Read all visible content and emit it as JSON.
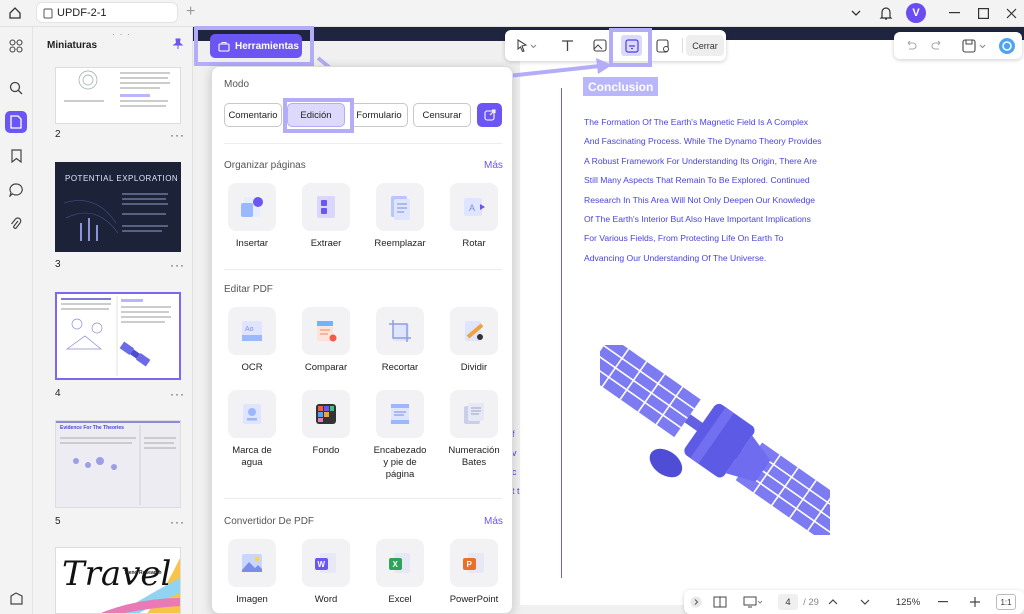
{
  "window": {
    "tab_title": "UPDF-2-1",
    "new_tab_symbol": "+",
    "avatar_letter": "V"
  },
  "thumbnails": {
    "title": "Miniaturas",
    "more_symbol": "···",
    "pages": [
      {
        "number": "2"
      },
      {
        "number": "3",
        "heading": "POTENTIAL EXPLORATION"
      },
      {
        "number": "4"
      },
      {
        "number": "5",
        "heading": "Evidence For The Theories"
      },
      {
        "number": "",
        "heading": "Travel",
        "subheading": "Trend Research"
      }
    ]
  },
  "toolbar": {
    "herramientas_label": "Herramientas",
    "close_label": "Cerrar"
  },
  "tools_panel": {
    "mode_title": "Modo",
    "modes": [
      {
        "label": "Comentario",
        "active": false
      },
      {
        "label": "Edición",
        "active": true
      },
      {
        "label": "Formulario",
        "active": false
      },
      {
        "label": "Censurar",
        "active": false
      }
    ],
    "organize": {
      "title": "Organizar páginas",
      "more": "Más",
      "tools": [
        {
          "label": "Insertar",
          "icon": "insert-icon"
        },
        {
          "label": "Extraer",
          "icon": "extract-icon"
        },
        {
          "label": "Reemplazar",
          "icon": "replace-icon"
        },
        {
          "label": "Rotar",
          "icon": "rotate-icon"
        }
      ]
    },
    "edit": {
      "title": "Editar PDF",
      "tools": [
        {
          "label": "OCR",
          "icon": "ocr-icon"
        },
        {
          "label": "Comparar",
          "icon": "compare-icon"
        },
        {
          "label": "Recortar",
          "icon": "crop-icon"
        },
        {
          "label": "Dividir",
          "icon": "split-icon"
        },
        {
          "label": "Marca de agua",
          "icon": "watermark-icon"
        },
        {
          "label": "Fondo",
          "icon": "background-icon"
        },
        {
          "label": "Encabezado y pie de página",
          "icon": "header-footer-icon"
        },
        {
          "label": "Numeración Bates",
          "icon": "bates-icon"
        }
      ]
    },
    "convert": {
      "title": "Convertidor De PDF",
      "more": "Más",
      "tools": [
        {
          "label": "Imagen",
          "icon": "image-icon"
        },
        {
          "label": "Word",
          "icon": "word-icon"
        },
        {
          "label": "Excel",
          "icon": "excel-icon"
        },
        {
          "label": "PowerPoint",
          "icon": "powerpoint-icon"
        }
      ]
    }
  },
  "document": {
    "heading": "Conclusion",
    "paragraph": "The Formation Of The Earth's Magnetic Field Is A Complex And Fascinating Process. While The Dynamo Theory Provides A Robust Framework For Understanding Its Origin, There Are Still Many Aspects That Remain To Be Explored. Continued Research In This Area Will Not Only Deepen Our Knowledge Of The Earth's Interior But Also Have Important Implications For Various Fields, From Protecting Life On Earth To Advancing Our Understanding Of The Universe.",
    "edge_letters": "f v c t t"
  },
  "bottom_bar": {
    "current_page": "4",
    "total_pages": "/ 29",
    "zoom": "125%",
    "fit_label": "1:1"
  },
  "colors": {
    "accent": "#6b55f3",
    "highlight": "#b3acf8",
    "text_blue": "#4a43e0"
  }
}
